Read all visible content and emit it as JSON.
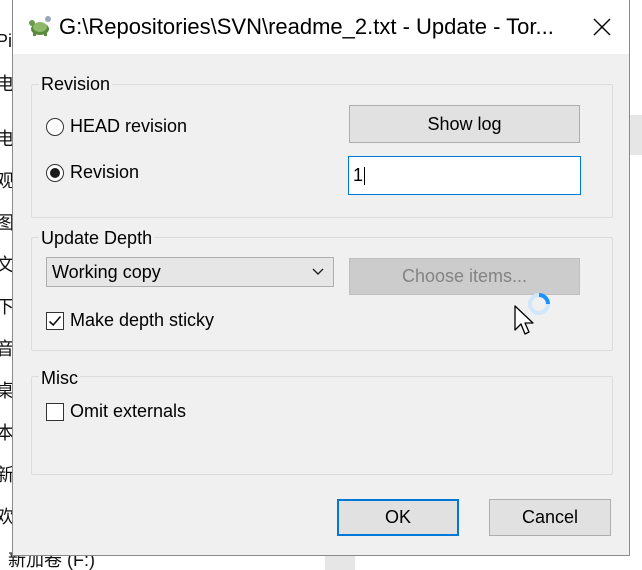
{
  "background": {
    "left_chars": [
      "Pi",
      "电",
      "电",
      "观",
      "图",
      "文",
      "下",
      "音",
      "桌",
      "本",
      "新",
      "欢"
    ],
    "bottom_text": "新加卷 (F:)"
  },
  "dialog": {
    "title": "G:\\Repositories\\SVN\\readme_2.txt - Update - Tor...",
    "icon": "tortoise-icon",
    "close_icon": "close-icon"
  },
  "revision": {
    "group_label": "Revision",
    "head_label": "HEAD revision",
    "revision_label": "Revision",
    "selected": "revision",
    "show_log_label": "Show log",
    "revision_value": "1"
  },
  "depth": {
    "group_label": "Update Depth",
    "selected_option": "Working copy",
    "choose_items_label": "Choose items...",
    "sticky_label": "Make depth sticky",
    "sticky_checked": true
  },
  "misc": {
    "group_label": "Misc",
    "omit_externals_label": "Omit externals",
    "omit_externals_checked": false
  },
  "footer": {
    "ok_label": "OK",
    "cancel_label": "Cancel"
  },
  "colors": {
    "accent": "#0078d7",
    "dialog_bg": "#f0f0f0",
    "button_bg": "#e1e1e1",
    "disabled_text": "#838383"
  }
}
